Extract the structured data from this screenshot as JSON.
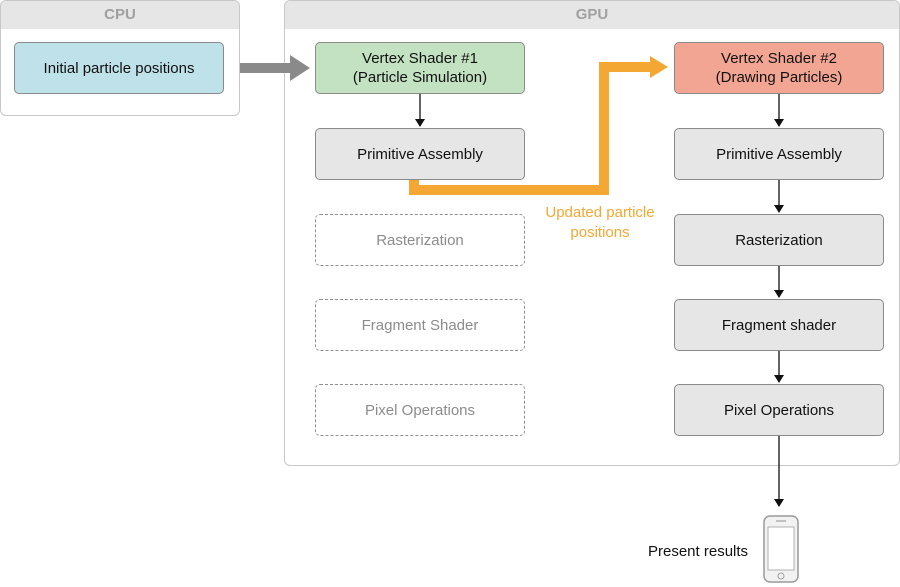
{
  "cpu": {
    "title": "CPU",
    "boxes": [
      {
        "label": "Initial particle positions",
        "color": "#bfe1ea"
      }
    ]
  },
  "gpu": {
    "title": "GPU",
    "left_column": [
      {
        "label": "Vertex Shader #1\n(Particle Simulation)",
        "style": "solid",
        "color": "#c3e2c2"
      },
      {
        "label": "Primitive Assembly",
        "style": "solid"
      },
      {
        "label": "Rasterization",
        "style": "dashed"
      },
      {
        "label": "Fragment Shader",
        "style": "dashed"
      },
      {
        "label": "Pixel Operations",
        "style": "dashed"
      }
    ],
    "right_column": [
      {
        "label": "Vertex Shader #2\n(Drawing Particles)",
        "style": "solid",
        "color": "#f3a593"
      },
      {
        "label": "Primitive Assembly",
        "style": "solid"
      },
      {
        "label": "Rasterization",
        "style": "solid"
      },
      {
        "label": "Fragment shader",
        "style": "solid"
      },
      {
        "label": "Pixel Operations",
        "style": "solid"
      }
    ]
  },
  "feedback_label": "Updated particle\npositions",
  "output": {
    "label": "Present results",
    "icon": "phone-icon"
  },
  "colors": {
    "feedback_arrow": "#f5a733",
    "cpu_arrow": "#8a8a8a"
  }
}
